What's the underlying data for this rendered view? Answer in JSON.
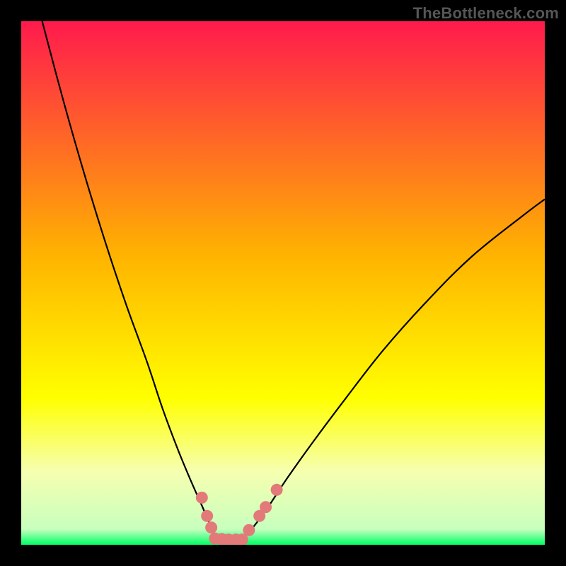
{
  "attribution": "TheBottleneck.com",
  "colors": {
    "bg": "#000000",
    "gradient_top": "#ff1a4d",
    "gradient_mid": "#ffb400",
    "gradient_yellow": "#ffff00",
    "gradient_pale": "#f6ffb0",
    "gradient_green": "#00ff66",
    "curve": "#000000",
    "marker_fill": "#e27a7a",
    "marker_stroke": "#b85555"
  },
  "chart_data": {
    "type": "line",
    "title": "",
    "xlabel": "",
    "ylabel": "",
    "xlim": [
      0,
      100
    ],
    "ylim": [
      0,
      100
    ],
    "series": [
      {
        "name": "left-curve",
        "x": [
          4,
          8,
          12,
          16,
          20,
          24,
          27,
          30,
          32.5,
          34.5,
          36,
          37,
          37.8
        ],
        "values": [
          100,
          85,
          71,
          58,
          46,
          35,
          26,
          18,
          12,
          7.5,
          4,
          2,
          1
        ]
      },
      {
        "name": "right-curve",
        "x": [
          42,
          44,
          47,
          51,
          56,
          62,
          69,
          77,
          86,
          96,
          100
        ],
        "values": [
          1,
          3,
          7,
          13,
          20,
          28,
          37,
          46,
          55,
          63,
          66
        ]
      },
      {
        "name": "floor",
        "x": [
          37.8,
          42
        ],
        "values": [
          1,
          1
        ]
      }
    ],
    "markers": [
      {
        "x": 34.5,
        "y": 9
      },
      {
        "x": 35.5,
        "y": 5.5
      },
      {
        "x": 36.3,
        "y": 3.3
      },
      {
        "x": 37.0,
        "y": 1.2
      },
      {
        "x": 38.3,
        "y": 1.1
      },
      {
        "x": 39.6,
        "y": 1.0
      },
      {
        "x": 41.0,
        "y": 1.0
      },
      {
        "x": 42.2,
        "y": 1.0
      },
      {
        "x": 43.5,
        "y": 2.8
      },
      {
        "x": 45.5,
        "y": 5.5
      },
      {
        "x": 46.7,
        "y": 7.2
      },
      {
        "x": 48.8,
        "y": 10.5
      }
    ]
  }
}
